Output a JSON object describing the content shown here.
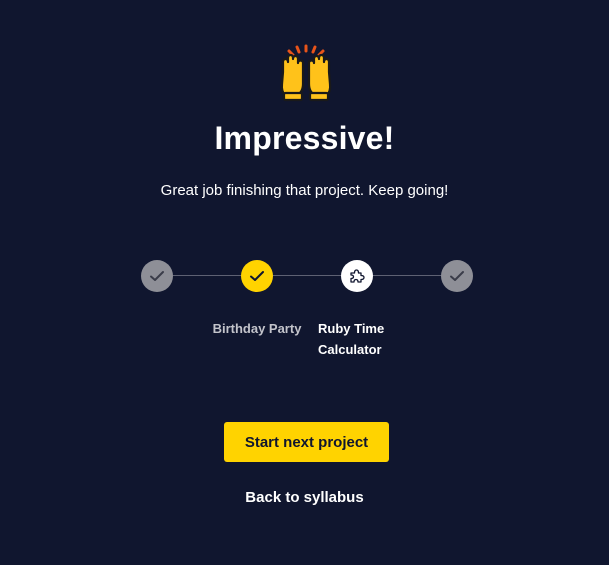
{
  "header": {
    "emoji_icon": "raising-hands-icon",
    "title": "Impressive!",
    "subtitle": "Great job finishing that project. Keep going!"
  },
  "progress": {
    "steps": [
      {
        "status": "completed",
        "icon": "check-icon",
        "label": ""
      },
      {
        "status": "current",
        "icon": "check-icon",
        "label": "Birthday Party"
      },
      {
        "status": "next",
        "icon": "puzzle-icon",
        "label": "Ruby Time Calculator"
      },
      {
        "status": "completed",
        "icon": "check-icon",
        "label": ""
      }
    ]
  },
  "actions": {
    "primary_label": "Start next project",
    "secondary_label": "Back to syllabus"
  },
  "colors": {
    "background": "#10162f",
    "accent": "#ffd300",
    "completed": "#8e8f97",
    "track": "#5e6173"
  }
}
